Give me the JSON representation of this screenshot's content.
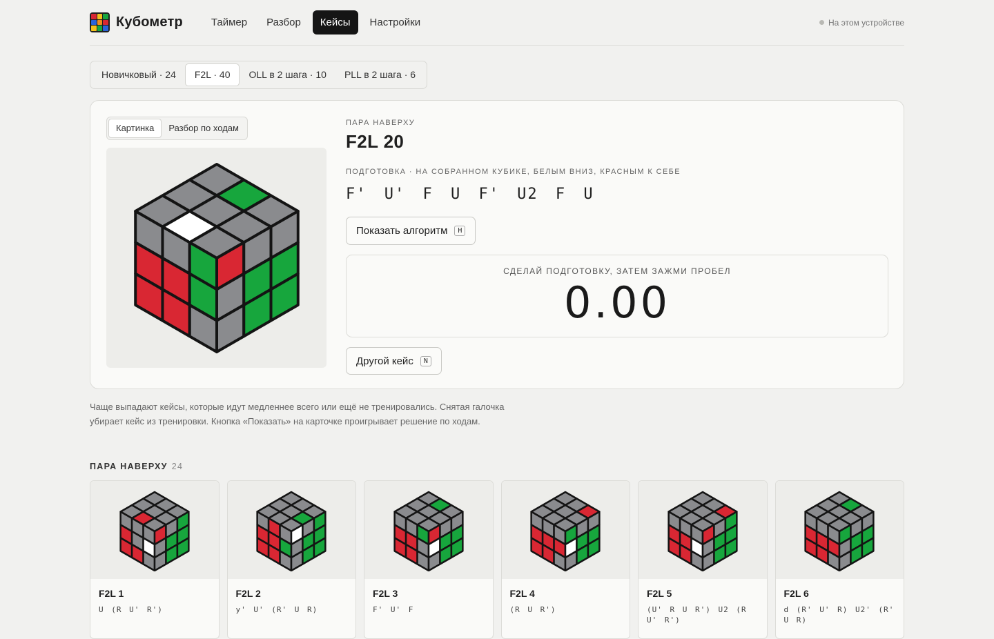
{
  "app": {
    "name": "Кубометр"
  },
  "nav": {
    "items": [
      "Таймер",
      "Разбор",
      "Кейсы",
      "Настройки"
    ],
    "active_index": 2
  },
  "device_status": "На этом устройстве",
  "case_sets": [
    {
      "label": "Новичковый · 24"
    },
    {
      "label": "F2L · 40",
      "active": true
    },
    {
      "label": "OLL в 2 шага · 10"
    },
    {
      "label": "PLL в 2 шага · 6"
    }
  ],
  "view_toggle": {
    "items": [
      "Картинка",
      "Разбор по ходам"
    ],
    "active_index": 0
  },
  "current_case": {
    "group": "ПАРА НАВЕРХУ",
    "title": "F2L 20",
    "setup_label": "ПОДГОТОВКА · НА СОБРАННОМ КУБИКЕ, БЕЛЫМ ВНИЗ, КРАСНЫМ К СЕБЕ",
    "setup_moves": "F' U' F U F' U2 F U",
    "cube": {
      "top": [
        "gray",
        "green",
        "gray",
        "gray",
        "gray",
        "gray",
        "gray",
        "white",
        "gray"
      ],
      "left": [
        "gray",
        "gray",
        "green",
        "red",
        "red",
        "green",
        "red",
        "red",
        "gray"
      ],
      "right": [
        "red",
        "gray",
        "gray",
        "gray",
        "green",
        "green",
        "gray",
        "green",
        "green"
      ]
    }
  },
  "buttons": {
    "show_algorithm": "Показать алгоритм",
    "show_algorithm_key": "H",
    "next_case": "Другой кейс",
    "next_case_key": "N"
  },
  "timer": {
    "hint": "СДЕЛАЙ ПОДГОТОВКУ, ЗАТЕМ ЗАЖМИ ПРОБЕЛ",
    "value": "0.00"
  },
  "note": "Чаще выпадают кейсы, которые идут медленнее всего или ещё не тренировались. Снятая галочка убирает кейс из тренировки. Кнопка «Показать» на карточке проигрывает решение по ходам.",
  "section": {
    "title": "ПАРА НАВЕРХУ",
    "count": "24"
  },
  "cases": [
    {
      "name": "F2L 1",
      "alg": "U (R U' R')",
      "cube": {
        "top": [
          "gray",
          "gray",
          "gray",
          "gray",
          "gray",
          "gray",
          "gray",
          "red",
          "gray"
        ],
        "left": [
          "gray",
          "gray",
          "gray",
          "red",
          "gray",
          "white",
          "red",
          "red",
          "gray"
        ],
        "right": [
          "red",
          "gray",
          "green",
          "gray",
          "green",
          "green",
          "gray",
          "green",
          "green"
        ]
      }
    },
    {
      "name": "F2L 2",
      "alg": "y' U' (R' U R)",
      "cube": {
        "top": [
          "gray",
          "gray",
          "gray",
          "gray",
          "gray",
          "green",
          "gray",
          "gray",
          "gray"
        ],
        "left": [
          "gray",
          "red",
          "gray",
          "red",
          "red",
          "green",
          "red",
          "red",
          "gray"
        ],
        "right": [
          "white",
          "gray",
          "green",
          "gray",
          "green",
          "green",
          "gray",
          "green",
          "green"
        ]
      }
    },
    {
      "name": "F2L 3",
      "alg": "F' U' F",
      "cube": {
        "top": [
          "gray",
          "green",
          "gray",
          "gray",
          "gray",
          "gray",
          "gray",
          "gray",
          "gray"
        ],
        "left": [
          "gray",
          "gray",
          "green",
          "red",
          "red",
          "gray",
          "red",
          "red",
          "gray"
        ],
        "right": [
          "red",
          "gray",
          "gray",
          "white",
          "green",
          "green",
          "gray",
          "green",
          "green"
        ]
      }
    },
    {
      "name": "F2L 4",
      "alg": "(R U R')",
      "cube": {
        "top": [
          "gray",
          "gray",
          "red",
          "gray",
          "gray",
          "gray",
          "gray",
          "gray",
          "gray"
        ],
        "left": [
          "gray",
          "gray",
          "gray",
          "red",
          "red",
          "red",
          "red",
          "red",
          "gray"
        ],
        "right": [
          "green",
          "gray",
          "gray",
          "white",
          "green",
          "green",
          "gray",
          "green",
          "green"
        ]
      }
    },
    {
      "name": "F2L 5",
      "alg": "(U' R U R') U2 (R U' R')",
      "cube": {
        "top": [
          "gray",
          "gray",
          "red",
          "gray",
          "gray",
          "gray",
          "gray",
          "gray",
          "gray"
        ],
        "left": [
          "gray",
          "gray",
          "gray",
          "red",
          "red",
          "white",
          "red",
          "red",
          "gray"
        ],
        "right": [
          "red",
          "gray",
          "green",
          "gray",
          "green",
          "green",
          "gray",
          "green",
          "green"
        ]
      }
    },
    {
      "name": "F2L 6",
      "alg": "d (R' U' R) U2' (R' U R)",
      "cube": {
        "top": [
          "gray",
          "green",
          "gray",
          "gray",
          "gray",
          "gray",
          "gray",
          "gray",
          "gray"
        ],
        "left": [
          "gray",
          "gray",
          "gray",
          "red",
          "red",
          "red",
          "red",
          "red",
          "gray"
        ],
        "right": [
          "green",
          "gray",
          "gray",
          "gray",
          "green",
          "green",
          "gray",
          "green",
          "green"
        ]
      }
    }
  ],
  "colors": {
    "gray": "#8a8b8e",
    "green": "#17a63d",
    "red": "#d92733",
    "white": "#ffffff",
    "yellow": "#f4c11a",
    "blue": "#2a63d9",
    "orange": "#f08a1d",
    "accent": "#151515"
  }
}
